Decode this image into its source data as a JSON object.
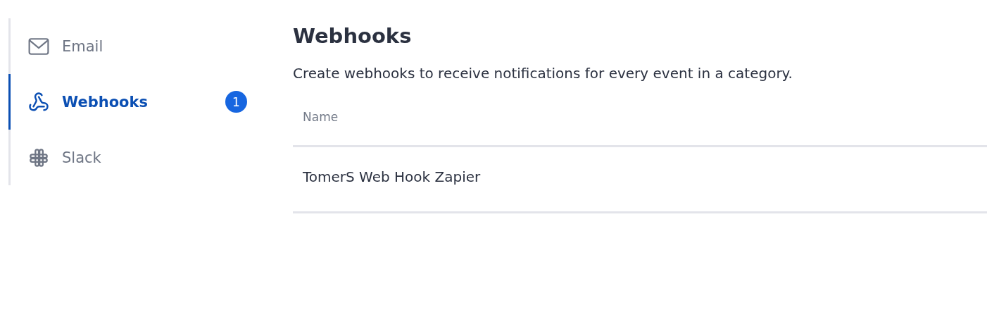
{
  "sidebar": {
    "items": [
      {
        "label": "Email",
        "selected": false
      },
      {
        "label": "Webhooks",
        "selected": true,
        "badge": "1"
      },
      {
        "label": "Slack",
        "selected": false
      }
    ]
  },
  "main": {
    "title": "Webhooks",
    "description": "Create webhooks to receive notifications for every event in a category.",
    "table": {
      "columns": [
        "Name"
      ],
      "rows": [
        [
          "TomerS Web Hook Zapier"
        ]
      ]
    }
  }
}
